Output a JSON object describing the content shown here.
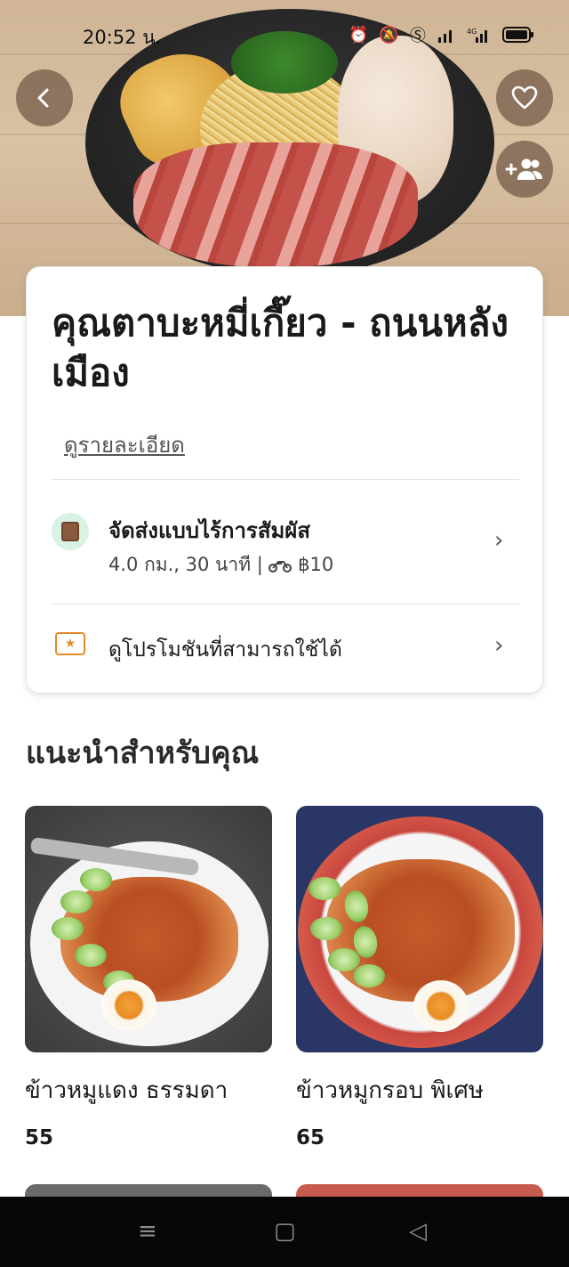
{
  "status_bar": {
    "time": "20:52 น.",
    "icons": [
      "alarm-icon",
      "bell-muted-icon",
      "shield-s-icon",
      "signal-icon",
      "4g-signal-icon",
      "battery-icon"
    ]
  },
  "hero": {
    "back_icon": "chevron-left-icon",
    "favorite_icon": "heart-icon",
    "group_order_icon": "add-group-icon"
  },
  "restaurant": {
    "name": "คุณตาบะหมี่เกี๊ยว - ถนนหลังเมือง",
    "details_link": "ดูรายละเอียด"
  },
  "delivery": {
    "title": "จัดส่งแบบไร้การสัมผัส",
    "distance_time": "4.0 กม., 30 นาที |",
    "fee": "฿10"
  },
  "promo": {
    "label": "ดูโปรโมชันที่สามารถใช้ได้"
  },
  "recommended": {
    "title": "แนะนำสำหรับคุณ",
    "items": [
      {
        "name": "ข้าวหมูแดง ธรรมดา",
        "price": "55"
      },
      {
        "name": "ข้าวหมูกรอบ พิเศษ",
        "price": "65"
      }
    ]
  },
  "nav_bar": {
    "menu_icon": "≡",
    "home_icon": "▢",
    "back_icon": "◁"
  }
}
